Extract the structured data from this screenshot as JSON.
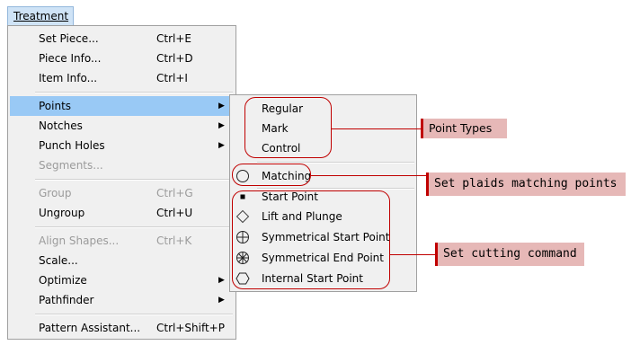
{
  "menu_title": "Treatment",
  "main_menu": [
    {
      "label": "Set Piece...",
      "shortcut": "Ctrl+E",
      "disabled": false,
      "submenu": false
    },
    {
      "label": "Piece Info...",
      "shortcut": "Ctrl+D",
      "disabled": false,
      "submenu": false
    },
    {
      "label": "Item Info...",
      "shortcut": "Ctrl+I",
      "disabled": false,
      "submenu": false
    },
    {
      "label": "Points",
      "shortcut": "",
      "disabled": false,
      "submenu": true,
      "highlighted": true
    },
    {
      "label": "Notches",
      "shortcut": "",
      "disabled": false,
      "submenu": true
    },
    {
      "label": "Punch Holes",
      "shortcut": "",
      "disabled": false,
      "submenu": true
    },
    {
      "label": "Segments...",
      "shortcut": "",
      "disabled": true,
      "submenu": false
    },
    {
      "label": "Group",
      "shortcut": "Ctrl+G",
      "disabled": true,
      "submenu": false
    },
    {
      "label": "Ungroup",
      "shortcut": "Ctrl+U",
      "disabled": false,
      "submenu": false
    },
    {
      "label": "Align Shapes...",
      "shortcut": "Ctrl+K",
      "disabled": true,
      "submenu": false
    },
    {
      "label": "Scale...",
      "shortcut": "",
      "disabled": false,
      "submenu": false
    },
    {
      "label": "Optimize",
      "shortcut": "",
      "disabled": false,
      "submenu": true
    },
    {
      "label": "Pathfinder",
      "shortcut": "",
      "disabled": false,
      "submenu": true
    },
    {
      "label": "Pattern Assistant...",
      "shortcut": "Ctrl+Shift+P",
      "disabled": false,
      "submenu": false
    }
  ],
  "submenu_arrow": "▶",
  "points_submenu": [
    {
      "label": "Regular",
      "icon": "none"
    },
    {
      "label": "Mark",
      "icon": "none"
    },
    {
      "label": "Control",
      "icon": "none"
    },
    {
      "label": "Matching",
      "icon": "circle-icon"
    },
    {
      "label": "Start Point",
      "icon": "filled-square-icon"
    },
    {
      "label": "Lift and Plunge",
      "icon": "diamond-icon"
    },
    {
      "label": "Symmetrical Start Point",
      "icon": "circle-cross-icon"
    },
    {
      "label": "Symmetrical End Point",
      "icon": "circle-asterisk-icon"
    },
    {
      "label": "Internal Start Point",
      "icon": "hexagon-icon"
    }
  ],
  "annotations": {
    "point_types": "Point Types",
    "matching": "Set plaids matching points",
    "cutting": "Set cutting command"
  },
  "colors": {
    "highlight": "#99c9f5",
    "annotation_red": "#c00000",
    "callout_fill": "#e6b8b7"
  }
}
